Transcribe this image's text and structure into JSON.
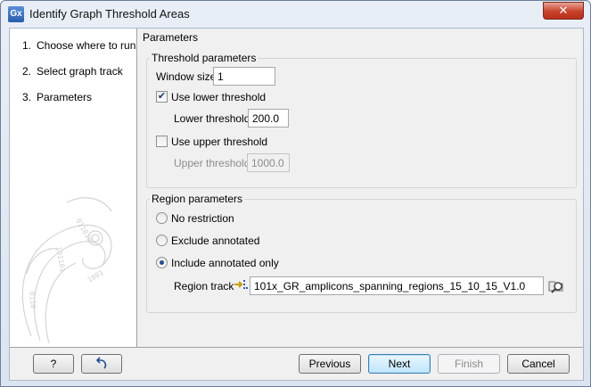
{
  "window": {
    "app_icon_text": "Gx",
    "title": "Identify Graph Threshold Areas",
    "close_glyph": "✕"
  },
  "steps": [
    {
      "num": "1.",
      "label": "Choose where to run"
    },
    {
      "num": "2.",
      "label": "Select graph track"
    },
    {
      "num": "3.",
      "label": "Parameters"
    }
  ],
  "panel": {
    "title": "Parameters",
    "threshold_group": {
      "title": "Threshold parameters",
      "window_size_label": "Window size",
      "window_size_value": "1",
      "use_lower_label": "Use lower threshold",
      "use_lower_checked": true,
      "lower_label": "Lower threshold",
      "lower_value": "200.0",
      "use_upper_label": "Use upper threshold",
      "use_upper_checked": false,
      "upper_label": "Upper threshold",
      "upper_value": "1000.0"
    },
    "region_group": {
      "title": "Region parameters",
      "options": [
        {
          "label": "No restriction",
          "checked": false
        },
        {
          "label": "Exclude annotated",
          "checked": false
        },
        {
          "label": "Include annotated only",
          "checked": true
        }
      ],
      "region_track_label": "Region track",
      "region_track_value": "101x_GR_amplicons_spanning_regions_15_10_15_V1.0",
      "track_icon": "track-icon",
      "browse_icon": "browse-icon"
    }
  },
  "buttons": {
    "help": "?",
    "reset_icon": "reset-icon",
    "previous": "Previous",
    "next": "Next",
    "finish": "Finish",
    "cancel": "Cancel"
  },
  "colors": {
    "close_red": "#c8412a",
    "accent_blue": "#3c7fb1",
    "radio_dot": "#1f4f91"
  }
}
